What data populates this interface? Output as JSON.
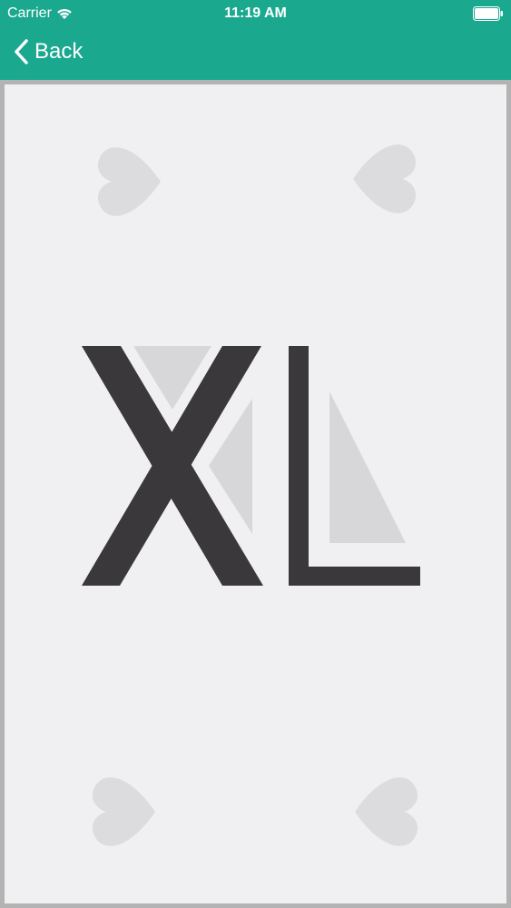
{
  "status_bar": {
    "carrier": "Carrier",
    "time": "11:19 AM"
  },
  "nav": {
    "back_label": "Back",
    "accent_color": "#1aa88f"
  },
  "card": {
    "logo_text": "XL",
    "suit_icon": "heart-icon",
    "logo_color": "#3a383b",
    "background_color": "#f0eff1"
  }
}
